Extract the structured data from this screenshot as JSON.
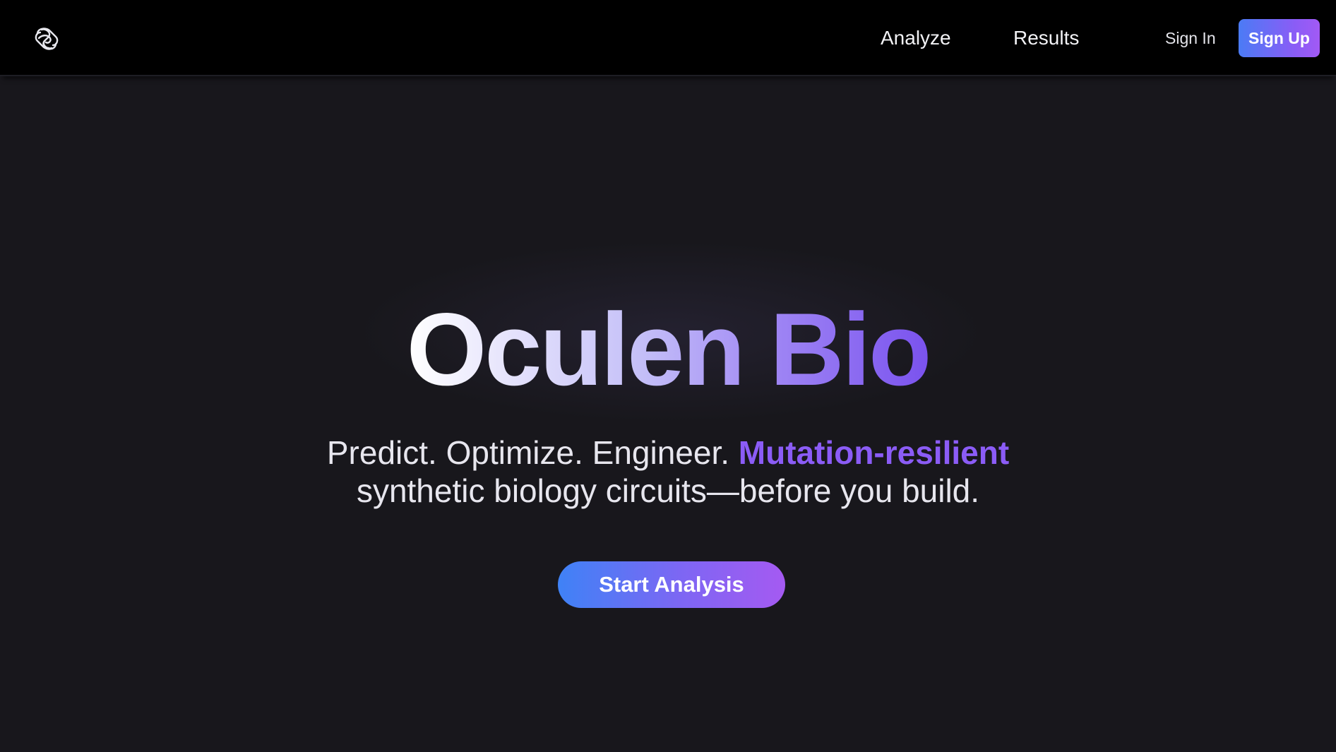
{
  "nav": {
    "logo_icon": "knot-logo-icon",
    "links": [
      {
        "label": "Analyze"
      },
      {
        "label": "Results"
      }
    ],
    "sign_in": "Sign In",
    "sign_up": "Sign Up"
  },
  "hero": {
    "title": "Oculen Bio",
    "subtitle_part1": "Predict. Optimize. Engineer.",
    "subtitle_highlight": "Mutation-resilient",
    "subtitle_line2": "synthetic biology circuits—before you build.",
    "cta": "Start Analysis"
  },
  "colors": {
    "background": "#18171c",
    "navbar": "#000000",
    "accent_purple": "#8b5cf6",
    "accent_blue": "#3f82f6"
  }
}
